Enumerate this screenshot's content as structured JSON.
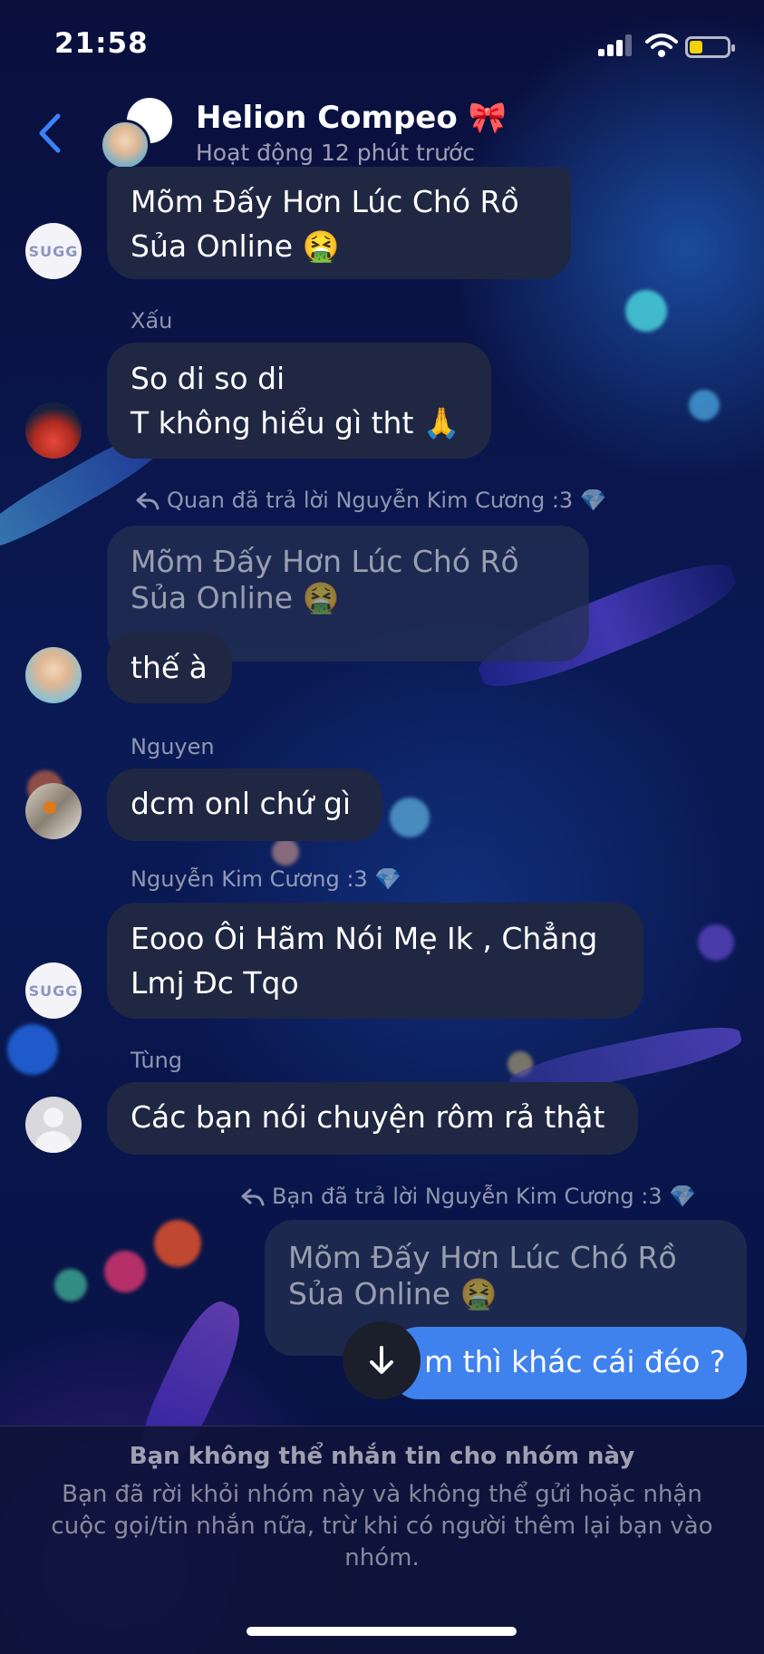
{
  "status_bar": {
    "time": "21:58"
  },
  "header": {
    "title": "Helion Compeo 🎀",
    "subtitle": "Hoạt động 12 phút trước"
  },
  "avatar_texts": {
    "sticker": "SUGG"
  },
  "messages": [
    {
      "text": "Mõm Đấy Hơn Lúc Chó Rồ\nSủa Online 🤮"
    },
    {
      "sender": "Xấu",
      "text": "So di so di\nT không hiểu gì tht 🙏"
    },
    {
      "reply_note": "Quan đã trả lời Nguyễn Kim Cương :3 💎",
      "quoted": "Mõm Đấy Hơn Lúc Chó Rồ\nSủa Online 🤮",
      "text": "thế à"
    },
    {
      "sender": "Nguyen",
      "text": "dcm onl chứ gì"
    },
    {
      "sender": "Nguyễn Kim Cương :3 💎",
      "text": "Eooo Ôi Hãm Nói Mẹ Ik , Chẳng\nLmj Đc Tqo"
    },
    {
      "sender": "Tùng",
      "text": "Các bạn nói chuyện rôm rả thật"
    },
    {
      "reply_note": "Bạn đã trả lời Nguyễn Kim Cương :3 💎",
      "quoted": "Mõm Đấy Hơn Lúc Chó Rồ\nSủa Online 🤮",
      "text": "m thì khác cái đéo ?"
    }
  ],
  "footer": {
    "title": "Bạn không thể nhắn tin cho nhóm này",
    "text": "Bạn đã rời khỏi nhóm này và không thể gửi hoặc nhận cuộc gọi/tin nhắn nữa, trừ khi có người thêm lại bạn vào nhóm."
  },
  "icons": {
    "back": "chevron-left-icon",
    "scroll_down": "arrow-down-icon",
    "reply": "reply-arrow-icon",
    "signal": "signal-icon",
    "wifi": "wifi-icon",
    "battery": "battery-icon"
  },
  "colors": {
    "accent_blue": "#3f82ee",
    "back_chevron": "#3b82f6",
    "bubble_other": "#1f2742",
    "battery_fill": "#f5d20a"
  }
}
